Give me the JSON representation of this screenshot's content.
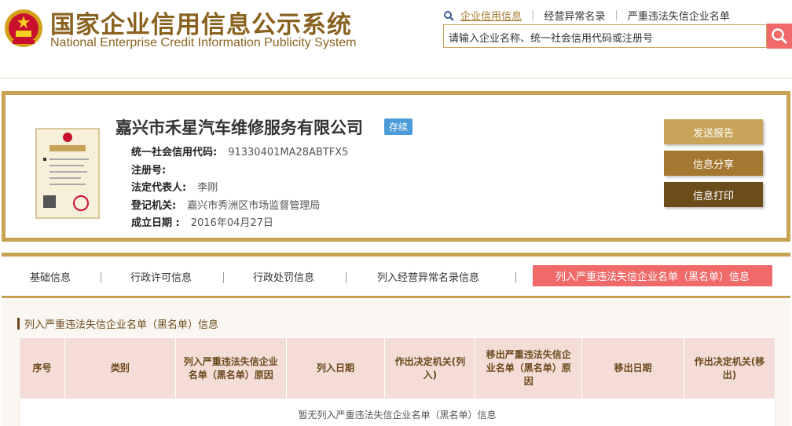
{
  "header": {
    "title_cn": "国家企业信用信息公示系统",
    "title_en": "National Enterprise Credit Information Publicity System",
    "links": [
      "企业信用信息",
      "经营异常名录",
      "严重违法失信企业名单"
    ],
    "search_placeholder": "请输入企业名称、统一社会信用代码或注册号",
    "emblem_icon": "national-emblem-icon",
    "search_icon": "search-icon"
  },
  "company": {
    "name": "嘉兴市禾星汽车维修服务有限公司",
    "status": "存续",
    "license_icon": "business-license-icon",
    "fields": [
      {
        "label": "统一社会信用代码:",
        "value": "91330401MA28ABTFX5"
      },
      {
        "label": "注册号:",
        "value": ""
      },
      {
        "label": "法定代表人:",
        "value": "李刚"
      },
      {
        "label": "登记机关:",
        "value": "嘉兴市秀洲区市场监督管理局"
      },
      {
        "label": "成立日期 :",
        "value": "2016年04月27日"
      }
    ],
    "actions": [
      "发送报告",
      "信息分享",
      "信息打印"
    ]
  },
  "tabs": {
    "items": [
      "基础信息",
      "行政许可信息",
      "行政处罚信息",
      "列入经营异常名录信息"
    ],
    "active": "列入严重违法失信企业名单（黑名单）信息"
  },
  "section": {
    "title": "列入严重违法失信企业名单（黑名单）信息",
    "columns": [
      "序号",
      "类别",
      "列入严重违法失信企业名单（黑名单）原因",
      "列入日期",
      "作出决定机关(列入)",
      "移出严重违法失信企业名单（黑名单）原因",
      "移出日期",
      "作出决定机关(移出)"
    ],
    "empty_text": "暂无列入严重违法失信企业名单（黑名单）信息"
  },
  "colors": {
    "gold": "#c7a253",
    "brown": "#8a6220",
    "red": "#f16a6a",
    "badge_blue": "#4a9bd8"
  }
}
